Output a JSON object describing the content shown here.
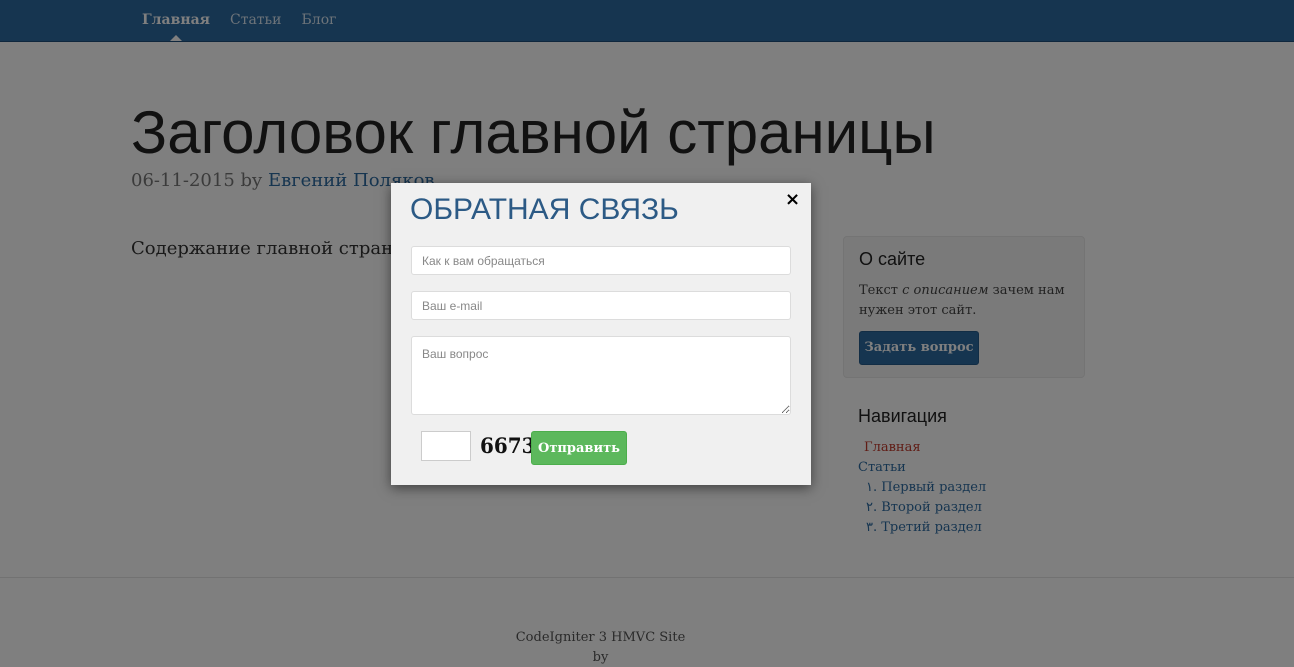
{
  "navbar": {
    "links": [
      {
        "label": "Главная",
        "active": true
      },
      {
        "label": "Статьи",
        "active": false
      },
      {
        "label": "Блог",
        "active": false
      }
    ]
  },
  "page": {
    "title": "Заголовок главной страницы",
    "date": "06-11-2015",
    "by": "by",
    "author": "Евгений Поляков",
    "content": "Содержание главной страницы"
  },
  "sidebar": {
    "about": {
      "title": "О сайте",
      "text_before": "Текст ",
      "text_em": "с описанием",
      "text_after": " зачем нам нужен этот сайт.",
      "button": "Задать вопрос"
    },
    "navigation": {
      "title": "Навигация",
      "items": [
        {
          "label": "Главная",
          "active": true
        },
        {
          "label": "Статьи",
          "active": false
        },
        {
          "label": "١. Первый раздел",
          "active": false
        },
        {
          "label": "٢. Второй раздел",
          "active": false
        },
        {
          "label": "٣. Третий раздел",
          "active": false
        }
      ]
    }
  },
  "footer": {
    "site": "CodeIgniter 3 HMVC Site",
    "by": "by"
  },
  "modal": {
    "title": "ОБРАТНАЯ СВЯЗЬ",
    "close": "×",
    "name_placeholder": "Как к вам обращаться",
    "email_placeholder": "Ваш e-mail",
    "question_placeholder": "Ваш вопрос",
    "captcha_code": "6673",
    "submit": "Отправить"
  },
  "colors": {
    "primary": "#2c6aa0",
    "modal_title": "#2c5a85",
    "success": "#5cb85c",
    "active_nav": "#c0392b"
  }
}
